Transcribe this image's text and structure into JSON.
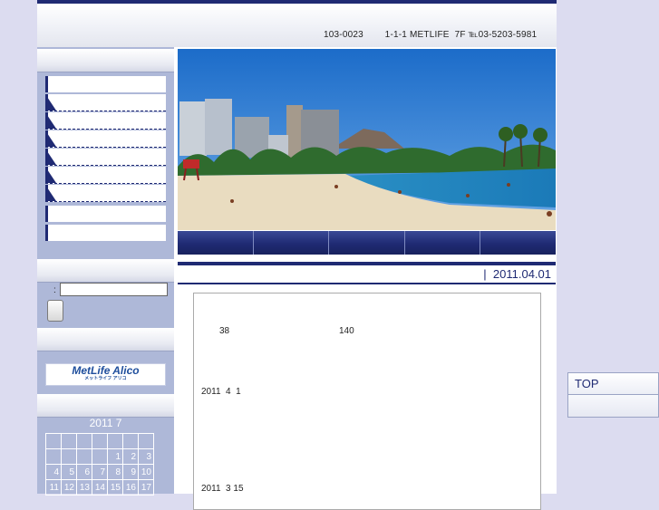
{
  "header": {
    "address": "103-0023        1-1-1 METLIFE  7F ℡03-5203-5981"
  },
  "sidebar": {
    "nav_item_count_note": "",
    "search": {
      "label": ":",
      "placeholder": ""
    },
    "banner": {
      "brand": "MetLife Alico",
      "sub": "メットライフ アリコ"
    },
    "calendar": {
      "title": "2011 7",
      "rows": [
        [
          "",
          "",
          "",
          "",
          "",
          "",
          ""
        ],
        [
          "",
          "",
          "",
          "",
          "1",
          "2",
          "3"
        ],
        [
          "4",
          "5",
          "6",
          "7",
          "8",
          "9",
          "10"
        ],
        [
          "11",
          "12",
          "13",
          "14",
          "15",
          "16",
          "17"
        ]
      ]
    }
  },
  "main": {
    "date": "|  2011.04.01",
    "content": {
      "line1_a": "38",
      "line1_b": "140",
      "line2": "2011  4  1",
      "line3": "2011  3 15"
    }
  },
  "floating": {
    "top_label": "TOP"
  },
  "colors": {
    "navy": "#1f2a73",
    "sidebar": "#aeb8d8",
    "background": "#dcdcf0"
  }
}
